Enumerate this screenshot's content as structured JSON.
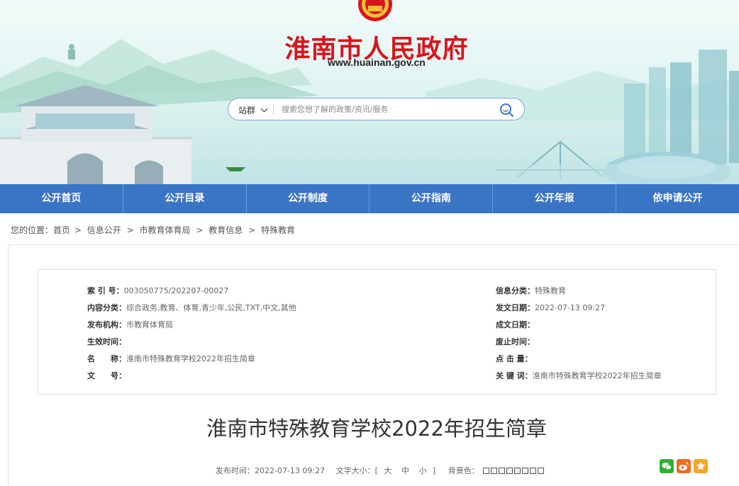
{
  "header": {
    "site_title": "淮南市人民政府",
    "site_url": "www.huainan.gov.cn",
    "search": {
      "scope_label": "站群",
      "placeholder": "搜索您想了解的政策/资讯/服务"
    }
  },
  "nav": {
    "items": [
      "公开首页",
      "公开目录",
      "公开制度",
      "公开指南",
      "公开年报",
      "依申请公开"
    ]
  },
  "breadcrumb": {
    "prefix": "您的位置：",
    "items": [
      "首页",
      "信息公开",
      "市教育体育局",
      "教育信息",
      "特殊教育"
    ],
    "separator": ">"
  },
  "meta": {
    "left": [
      {
        "label": "索 引 号：",
        "value": "003050775/202207-00027"
      },
      {
        "label": "内容分类：",
        "value": "综合政务,教育、体育,青少年,公民,TXT,中文,其他"
      },
      {
        "label": "发布机构：",
        "value": "市教育体育局"
      },
      {
        "label": "生效时间：",
        "value": ""
      },
      {
        "label": "名　　称：",
        "value": "淮南市特殊教育学校2022年招生简章"
      },
      {
        "label": "文　　号：",
        "value": ""
      }
    ],
    "right": [
      {
        "label": "信息分类：",
        "value": "特殊教育"
      },
      {
        "label": "发文日期：",
        "value": "2022-07-13 09:27"
      },
      {
        "label": "成文日期：",
        "value": ""
      },
      {
        "label": "废止时间：",
        "value": ""
      },
      {
        "label": "点 击 量：",
        "value": ""
      },
      {
        "label": "关 键 词：",
        "value": "淮南市特殊教育学校2022年招生简章"
      }
    ]
  },
  "article": {
    "title": "淮南市特殊教育学校2022年招生简章",
    "publish_label": "发布时间：",
    "publish_time": "2022-07-13 09:27",
    "font_size_label": "文字大小：[",
    "font_sizes": [
      "大",
      "中",
      "小"
    ],
    "font_size_close": "]",
    "bg_color_label": "背景色：",
    "bg_colors": [
      "#ffffff",
      "#fbeef0",
      "#faf7e9",
      "#eaf6ef",
      "#f1ecf6",
      "#eaf1fb",
      "#f3f3f3",
      "#f8f8f8"
    ]
  },
  "share": {
    "icons": [
      "wechat-icon",
      "weibo-icon",
      "favorite-icon"
    ],
    "colors": {
      "wechat": "#2fb12f",
      "weibo": "#ef6b1f",
      "favorite": "#f5a623"
    }
  },
  "colors": {
    "nav_bg": "#3a74c4",
    "title_red": "#d7151b"
  }
}
